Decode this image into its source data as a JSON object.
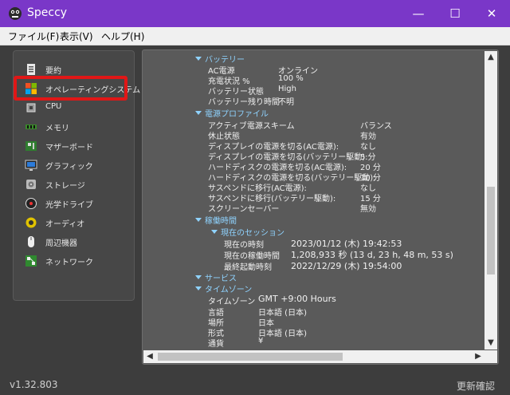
{
  "titlebar": {
    "app_name": "Speccy",
    "minimize": "—",
    "maximize": "☐",
    "close": "✕"
  },
  "menu": [
    "ファイル(F)",
    "表示(V)",
    "ヘルプ(H)"
  ],
  "sidebar": {
    "items": [
      {
        "label": "要約",
        "icon": "summary-icon"
      },
      {
        "label": "オペレーティングシステム",
        "icon": "windows-icon"
      },
      {
        "label": "CPU",
        "icon": "cpu-icon"
      },
      {
        "label": "メモリ",
        "icon": "memory-icon"
      },
      {
        "label": "マザーボード",
        "icon": "motherboard-icon"
      },
      {
        "label": "グラフィック",
        "icon": "graphics-icon"
      },
      {
        "label": "ストレージ",
        "icon": "storage-icon"
      },
      {
        "label": "光学ドライブ",
        "icon": "optical-drive-icon"
      },
      {
        "label": "オーディオ",
        "icon": "audio-icon"
      },
      {
        "label": "周辺機器",
        "icon": "peripherals-icon"
      },
      {
        "label": "ネットワーク",
        "icon": "network-icon"
      }
    ],
    "selected": "オペレーティングシステム"
  },
  "content": {
    "battery": {
      "title": "バッテリー",
      "rows": [
        {
          "key": "AC電源",
          "value": "オンライン"
        },
        {
          "key": "充電状況 %",
          "value": "100 %"
        },
        {
          "key": "バッテリー状態",
          "value": "High"
        },
        {
          "key": "バッテリー残り時間",
          "value": "不明"
        }
      ]
    },
    "power": {
      "title": "電源プロファイル",
      "rows": [
        {
          "key": "アクティブ電源スキーム",
          "value": "バランス"
        },
        {
          "key": "休止状態",
          "value": "有効"
        },
        {
          "key": "ディスプレイの電源を切る(AC電源):",
          "value": "なし"
        },
        {
          "key": "ディスプレイの電源を切る(バッテリー駆動):",
          "value": "5 分"
        },
        {
          "key": "ハードディスクの電源を切る(AC電源):",
          "value": "20 分"
        },
        {
          "key": "ハードディスクの電源を切る(バッテリー駆動):",
          "value": "10 分"
        },
        {
          "key": "サスペンドに移行(AC電源):",
          "value": "なし"
        },
        {
          "key": "サスペンドに移行(バッテリー駆動):",
          "value": "15 分"
        },
        {
          "key": "スクリーンセーバー",
          "value": "無効"
        }
      ]
    },
    "uptime": {
      "title": "稼働時間",
      "session_title": "現在のセッション",
      "rows": [
        {
          "key": "現在の時刻",
          "value": "2023/01/12 (木) 19:42:53"
        },
        {
          "key": "現在の稼働時間",
          "value": "1,208,933 秒 (13 d, 23 h, 48 m, 53 s)"
        },
        {
          "key": "最終起動時刻",
          "value": "2022/12/29 (木) 19:54:00"
        }
      ]
    },
    "services": {
      "title": "サービス"
    },
    "timezone": {
      "title": "タイムゾーン",
      "rows": [
        {
          "key": "タイムゾーン",
          "value": "GMT +9:00 Hours"
        },
        {
          "key": "言語",
          "value": "日本語 (日本)"
        },
        {
          "key": "場所",
          "value": "日本"
        },
        {
          "key": "形式",
          "value": "日本語 (日本)"
        },
        {
          "key": "通貨",
          "value": "¥"
        }
      ]
    }
  },
  "status": {
    "version": "v1.32.803",
    "update": "更新確認"
  },
  "colors": {
    "titlebar": "#7a37c8",
    "section": "#8fd3ff",
    "highlight": "#e01717"
  }
}
